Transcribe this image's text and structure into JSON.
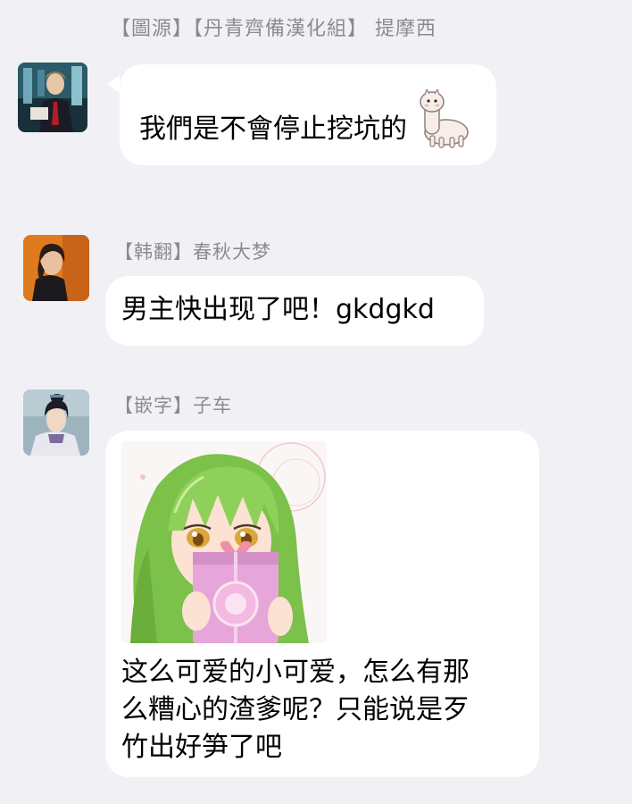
{
  "top_credit": "【圖源】【丹青齊備漢化組】 提摩西",
  "messages": [
    {
      "sender": "",
      "text": "我們是不會停止挖坑的",
      "sticker": "alpaca-sticker"
    },
    {
      "sender": "【韩翻】春秋大梦",
      "text": "男主快出现了吧！gkdgkd"
    },
    {
      "sender": "【嵌字】子车",
      "image": "green-haired-girl-holding-gift-sticker",
      "lines": [
        "这么可爱的小可爱，怎么有那",
        "么糟心的渣爹呢？只能说是歹",
        "竹出好笋了吧"
      ]
    }
  ],
  "colors": {
    "background": "#f1f1f5",
    "bubble": "#ffffff",
    "sender_text": "#8a8a90",
    "message_text": "#151515"
  }
}
